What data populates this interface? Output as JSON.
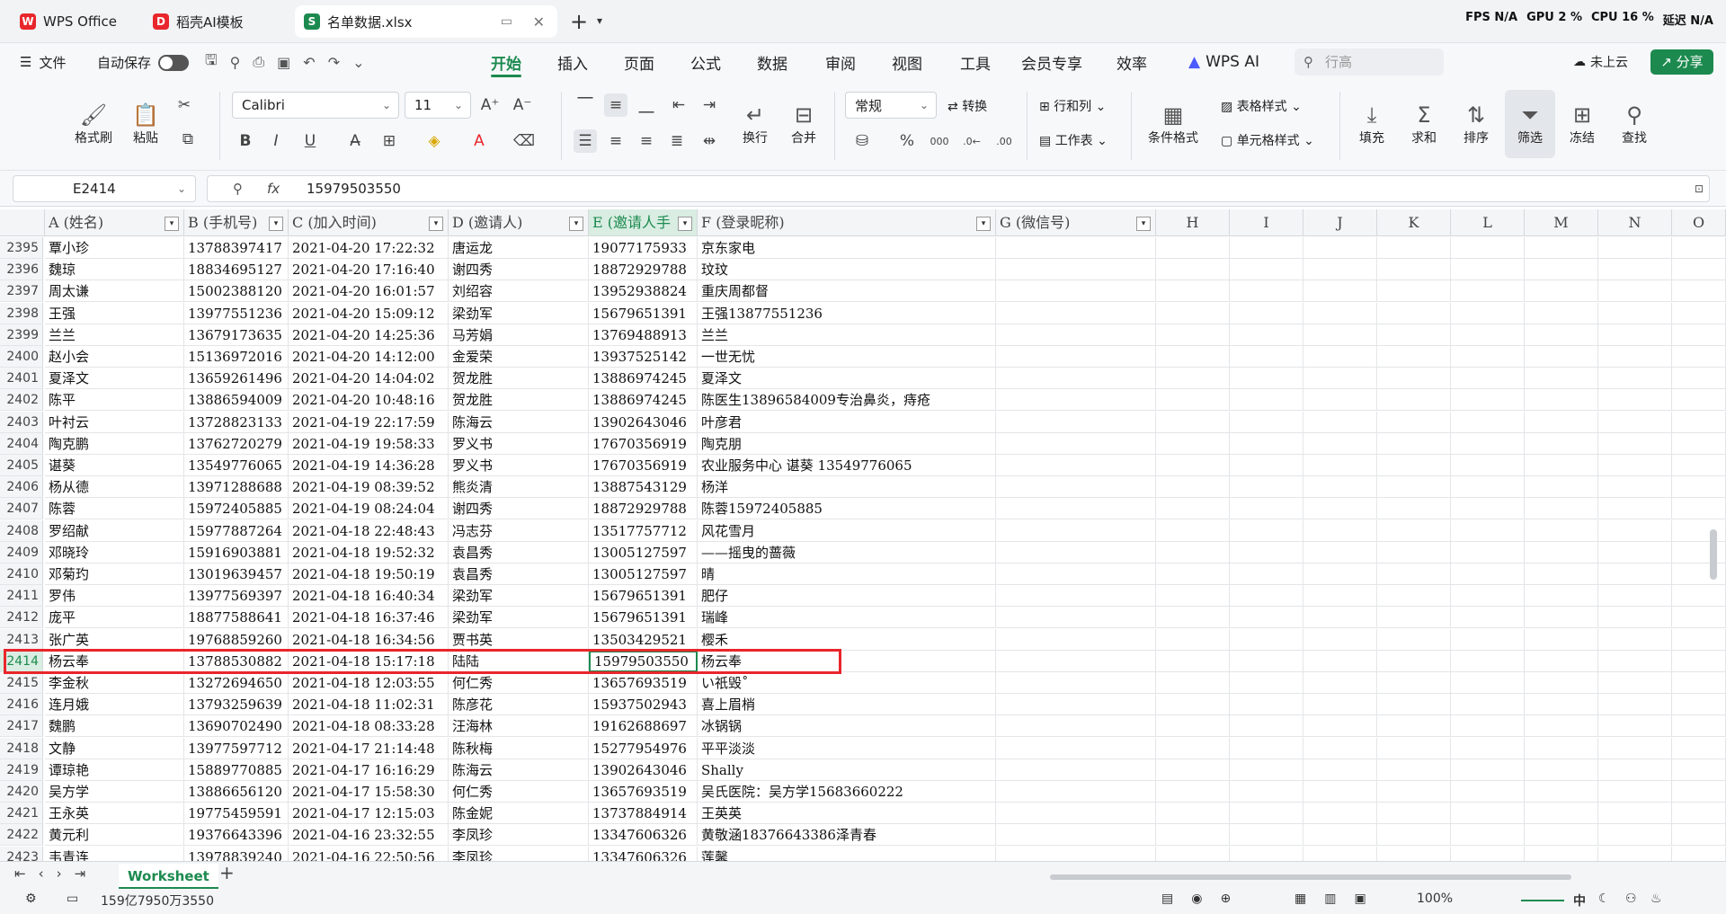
{
  "tabs": [
    {
      "label": "WPS Office"
    },
    {
      "label": "稻壳AI模板"
    },
    {
      "label": "名单数据.xlsx"
    }
  ],
  "sysinfo": {
    "fps": "FPS N/A",
    "gpu": "GPU 2 %",
    "cpu": "CPU 16 %",
    "latency": "延迟 N/A"
  },
  "menu": {
    "file": "文件",
    "autosave": "自动保存",
    "tabs": [
      "开始",
      "插入",
      "页面",
      "公式",
      "数据",
      "审阅",
      "视图",
      "工具",
      "会员专享",
      "效率"
    ],
    "wps_ai": "WPS AI",
    "search_placeholder": "行高",
    "cloud": "未上云",
    "share": "分享"
  },
  "ribbon": {
    "format_painter": "格式刷",
    "paste": "粘贴",
    "font": "Calibri",
    "font_size": "11",
    "number_format": "常规",
    "convert": "转换",
    "row_col": "行和列",
    "worksheet": "工作表",
    "wrap": "换行",
    "merge": "合并",
    "cond_format": "条件格式",
    "table_style": "表格样式",
    "cell_style": "单元格样式",
    "fill": "填充",
    "sum": "求和",
    "sort": "排序",
    "filter": "筛选",
    "freeze": "冻结",
    "find": "查找"
  },
  "formula_bar": {
    "cell_ref": "E2414",
    "fx": "fx",
    "value": "15979503550"
  },
  "columns": [
    "A (姓名)",
    "B (手机号)",
    "C (加入时间)",
    "D (邀请人)",
    "E (邀请人手",
    "F (登录昵称)",
    "G (微信号)",
    "H",
    "I",
    "J",
    "K",
    "L",
    "M",
    "N",
    "O"
  ],
  "rows": [
    [
      "2395",
      "覃小珍",
      "13788397417",
      "2021-04-20 17:22:32",
      "唐运龙",
      "19077175933",
      "京东家电"
    ],
    [
      "2396",
      "魏琼",
      "18834695127",
      "2021-04-20 17:16:40",
      "谢四秀",
      "18872929788",
      "玟玟"
    ],
    [
      "2397",
      "周太谦",
      "15002388120",
      "2021-04-20 16:01:57",
      "刘绍容",
      "13952938824",
      "重庆周都督"
    ],
    [
      "2398",
      "王强",
      "13977551236",
      "2021-04-20 15:09:12",
      "梁劲军",
      "15679651391",
      "王强13877551236"
    ],
    [
      "2399",
      "兰兰",
      "13679173635",
      "2021-04-20 14:25:36",
      "马芳娟",
      "13769488913",
      "兰兰"
    ],
    [
      "2400",
      "赵小会",
      "15136972016",
      "2021-04-20 14:12:00",
      "金爱荣",
      "13937525142",
      "一世无忧"
    ],
    [
      "2401",
      "夏泽文",
      "13659261496",
      "2021-04-20 14:04:02",
      "贺龙胜",
      "13886974245",
      "夏泽文"
    ],
    [
      "2402",
      "陈平",
      "13886594009",
      "2021-04-20 10:48:16",
      "贺龙胜",
      "13886974245",
      "陈医生13896584009专治鼻炎，痔疮"
    ],
    [
      "2403",
      "叶衬云",
      "13728823133",
      "2021-04-19 22:17:59",
      "陈海云",
      "13902643046",
      "叶彦君"
    ],
    [
      "2404",
      "陶克鹏",
      "13762720279",
      "2021-04-19 19:58:33",
      "罗义书",
      "17670356919",
      "陶克朋"
    ],
    [
      "2405",
      "谌葵",
      "13549776065",
      "2021-04-19 14:36:28",
      "罗义书",
      "17670356919",
      "农业服务中心 谌葵 13549776065"
    ],
    [
      "2406",
      "杨从德",
      "13971288688",
      "2021-04-19 08:39:52",
      "熊炎清",
      "13887543129",
      "杨洋"
    ],
    [
      "2407",
      "陈蓉",
      "15972405885",
      "2021-04-19 08:24:04",
      "谢四秀",
      "18872929788",
      "陈蓉15972405885"
    ],
    [
      "2408",
      "罗绍献",
      "15977887264",
      "2021-04-18 22:48:43",
      "冯志芬",
      "13517757712",
      "风花雪月"
    ],
    [
      "2409",
      "邓晓玲",
      "15916903881",
      "2021-04-18 19:52:32",
      "袁昌秀",
      "13005127597",
      "——摇曳的蔷薇"
    ],
    [
      "2410",
      "邓菊玓",
      "13019639457",
      "2021-04-18 19:50:19",
      "袁昌秀",
      "13005127597",
      "晴"
    ],
    [
      "2411",
      "罗伟",
      "13977569397",
      "2021-04-18 16:40:34",
      "梁劲军",
      "15679651391",
      "肥仔"
    ],
    [
      "2412",
      "庞平",
      "18877588641",
      "2021-04-18 16:37:46",
      "梁劲军",
      "15679651391",
      "瑞峰"
    ],
    [
      "2413",
      "张广英",
      "19768859260",
      "2021-04-18 16:34:56",
      "贾书英",
      "13503429521",
      "樱禾"
    ],
    [
      "2414",
      "杨云奉",
      "13788530882",
      "2021-04-18 15:17:18",
      "陆陆",
      "15979503550",
      "杨云奉"
    ],
    [
      "2415",
      "李金秋",
      "13272694650",
      "2021-04-18 12:03:55",
      "何仁秀",
      "13657693519",
      "い祇毁˚"
    ],
    [
      "2416",
      "连月娥",
      "13793259639",
      "2021-04-18 11:02:31",
      "陈彦花",
      "15937502943",
      "喜上眉梢"
    ],
    [
      "2417",
      "魏鹏",
      "13690702490",
      "2021-04-18 08:33:28",
      "汪海林",
      "19162688697",
      "冰锅锅"
    ],
    [
      "2418",
      "文静",
      "13977597712",
      "2021-04-17 21:14:48",
      "陈秋梅",
      "15277954976",
      "平平淡淡"
    ],
    [
      "2419",
      "谭琼艳",
      "15889770885",
      "2021-04-17 16:16:29",
      "陈海云",
      "13902643046",
      "Shally"
    ],
    [
      "2420",
      "吴方学",
      "13886656120",
      "2021-04-17 15:58:30",
      "何仁秀",
      "13657693519",
      "吴氏医院：吴方学15683660222"
    ],
    [
      "2421",
      "王永英",
      "19775459591",
      "2021-04-17 12:15:03",
      "陈金妮",
      "13737884914",
      "王英英"
    ],
    [
      "2422",
      "黄元利",
      "19376643396",
      "2021-04-16 23:32:55",
      "李凤珍",
      "13347606326",
      "黄敬涵18376643386泽青春"
    ],
    [
      "2423",
      "韦青连",
      "13978839240",
      "2021-04-16 22:50:56",
      "李凤珍",
      "13347606326",
      "莲馨"
    ]
  ],
  "sheet_tab": "Worksheet",
  "status": {
    "sum": "159亿7950万3550",
    "zoom": "100%",
    "ime": "中"
  },
  "colors": {
    "accent": "#1c8a4f",
    "highlight": "#e8262b"
  }
}
